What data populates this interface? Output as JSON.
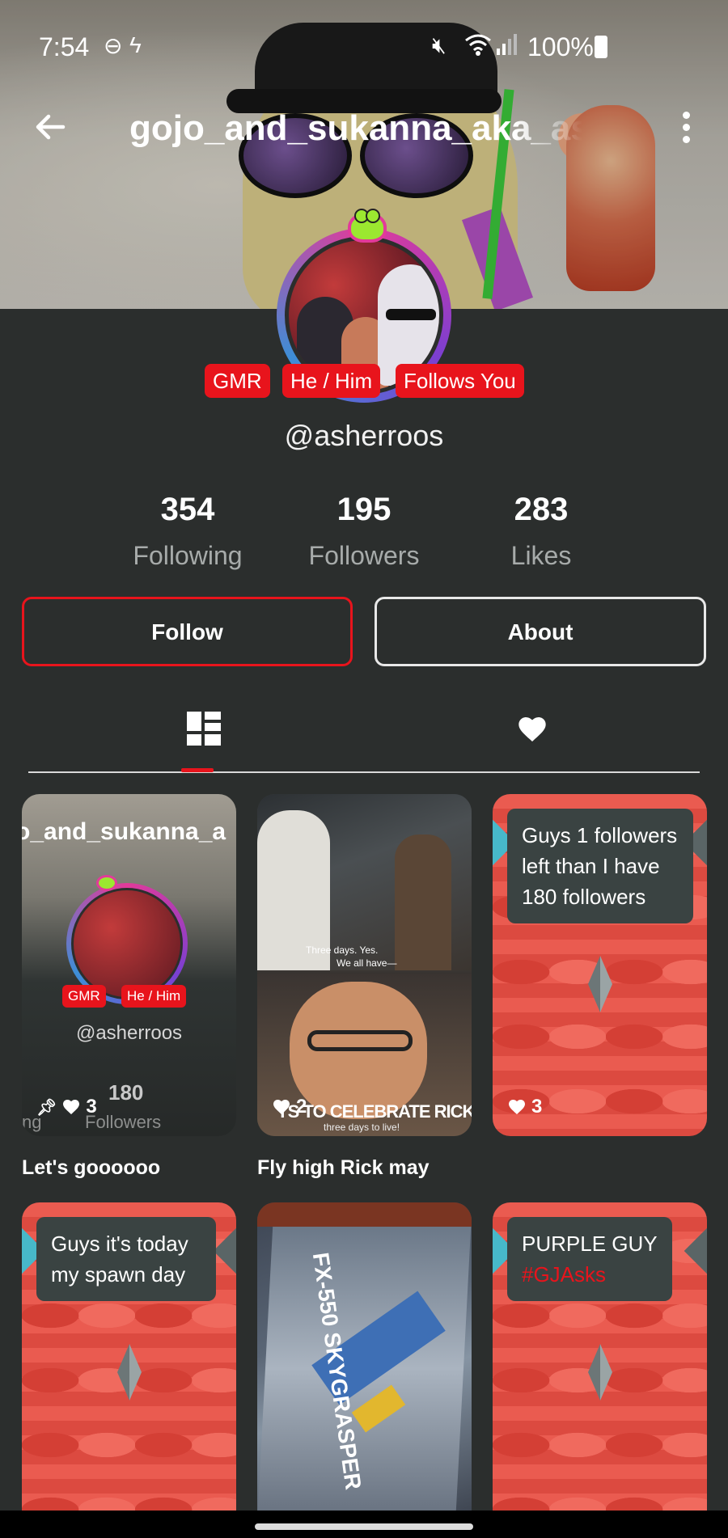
{
  "status_bar": {
    "time": "7:54",
    "battery_text": "100%",
    "icons": [
      "do-not-disturb-icon",
      "flash-icon",
      "mute-icon",
      "wifi-icon",
      "signal-icon",
      "battery-icon"
    ]
  },
  "profile": {
    "title": "gojo_and_sukanna_aka_asherroos",
    "handle": "@asherroos",
    "badges": [
      "GMR",
      "He / Him",
      "Follows You"
    ],
    "stats": [
      {
        "value": "354",
        "label": "Following"
      },
      {
        "value": "195",
        "label": "Followers"
      },
      {
        "value": "283",
        "label": "Likes"
      }
    ],
    "buttons": {
      "follow": "Follow",
      "about": "About"
    }
  },
  "tabs": {
    "active": "posts",
    "items": [
      "posts-grid-icon",
      "liked-heart-icon"
    ]
  },
  "posts": [
    {
      "caption": "Let's goooooo",
      "likes": "3",
      "pinned": true,
      "inner": {
        "title": "o_and_sukanna_a",
        "badges": [
          "GMR",
          "He / Him"
        ],
        "handle": "@asherroos",
        "followers_value": "180",
        "followers_label": "Followers",
        "left_fragment": "ng"
      }
    },
    {
      "caption": "Fly high Rick may",
      "likes": "2",
      "meme_top": "Three days. Yes.",
      "meme_top2": "We all have—",
      "meme_bottom": "YS TO CELEBRATE RICK MAY BI",
      "meme_bottom2": "three days to live!"
    },
    {
      "caption": "",
      "likes": "3",
      "note": "Guys 1 followers left than I have 180 followers"
    },
    {
      "caption": "",
      "likes": "",
      "note": "Guys it's today my spawn day"
    },
    {
      "caption": "",
      "likes": "",
      "box_text": "FX-550 SKYGRASPER"
    },
    {
      "caption": "",
      "likes": "",
      "note": "PURPLE GUY",
      "tag": "#GJAsks"
    }
  ],
  "colors": {
    "accent": "#e8141c",
    "background": "#2b2e2d",
    "muted": "#a7abaa"
  }
}
